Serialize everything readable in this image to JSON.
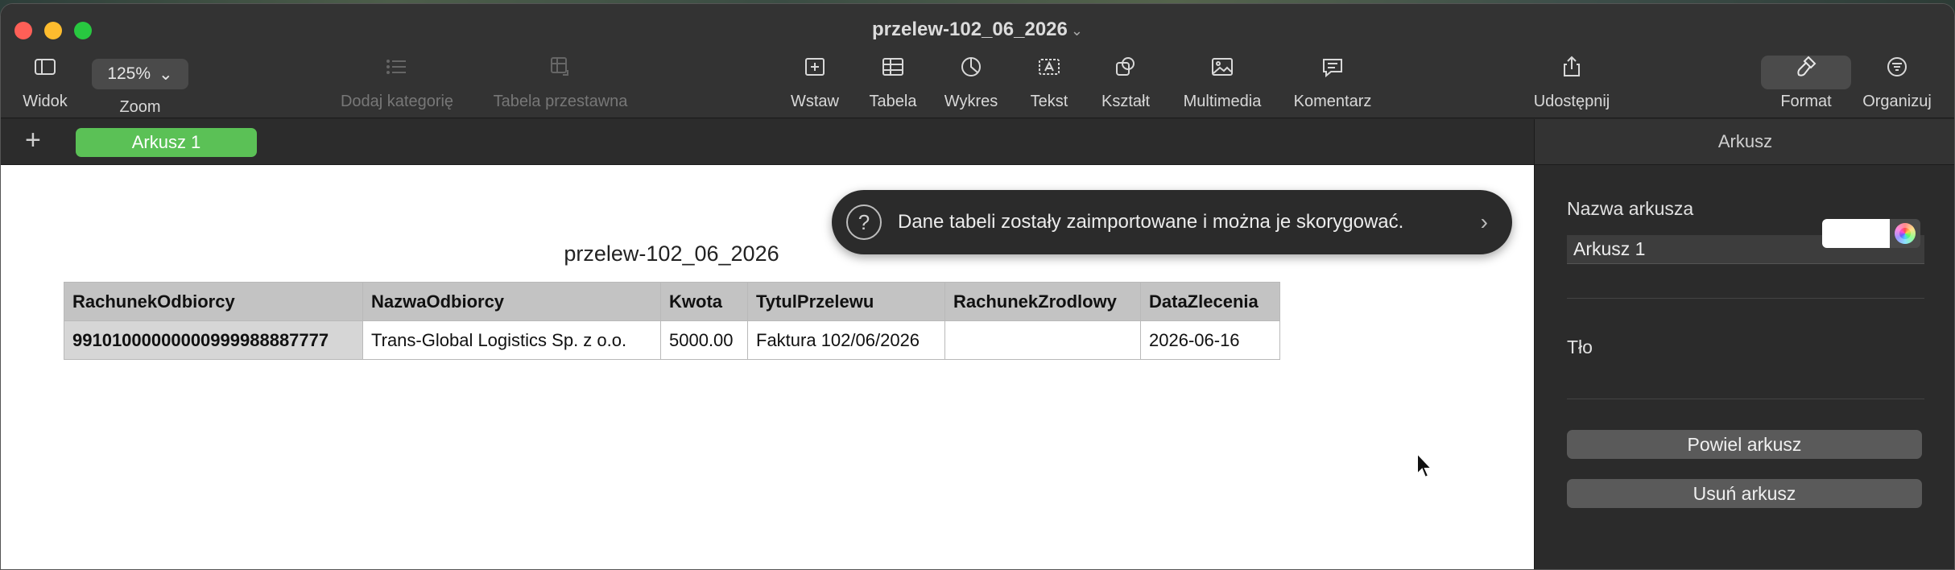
{
  "window": {
    "title": "przelew-102_06_2026"
  },
  "toolbar": {
    "view": "Widok",
    "zoom_value": "125%",
    "zoom": "Zoom",
    "add_category": "Dodaj kategorię",
    "pivot_table": "Tabela przestawna",
    "insert": "Wstaw",
    "table": "Tabela",
    "chart": "Wykres",
    "text": "Tekst",
    "shape": "Kształt",
    "media": "Multimedia",
    "comment": "Komentarz",
    "share": "Udostępnij",
    "format": "Format",
    "organize": "Organizuj"
  },
  "tabs": {
    "add": "+",
    "active": "Arkusz 1"
  },
  "canvas": {
    "table_title": "przelew-102_06_2026",
    "headers": [
      "RachunekOdbiorcy",
      "NazwaOdbiorcy",
      "Kwota",
      "TytulPrzelewu",
      "RachunekZrodlowy",
      "DataZlecenia"
    ],
    "rows": [
      [
        "99101000000000999988887777",
        "Trans-Global Logistics Sp. z o.o.",
        "5000.00",
        "Faktura 102/06/2026",
        "",
        "2026-06-16"
      ]
    ],
    "toast": "Dane tabeli zostały zaimportowane i można je skorygować."
  },
  "sidebar": {
    "header": "Arkusz",
    "sheet_name_label": "Nazwa arkusza",
    "sheet_name_value": "Arkusz 1",
    "background_label": "Tło",
    "background_color": "#ffffff",
    "duplicate": "Powiel arkusz",
    "delete": "Usuń arkusz"
  },
  "colors": {
    "tab_active": "#5bc156",
    "toolbar": "#333333"
  }
}
